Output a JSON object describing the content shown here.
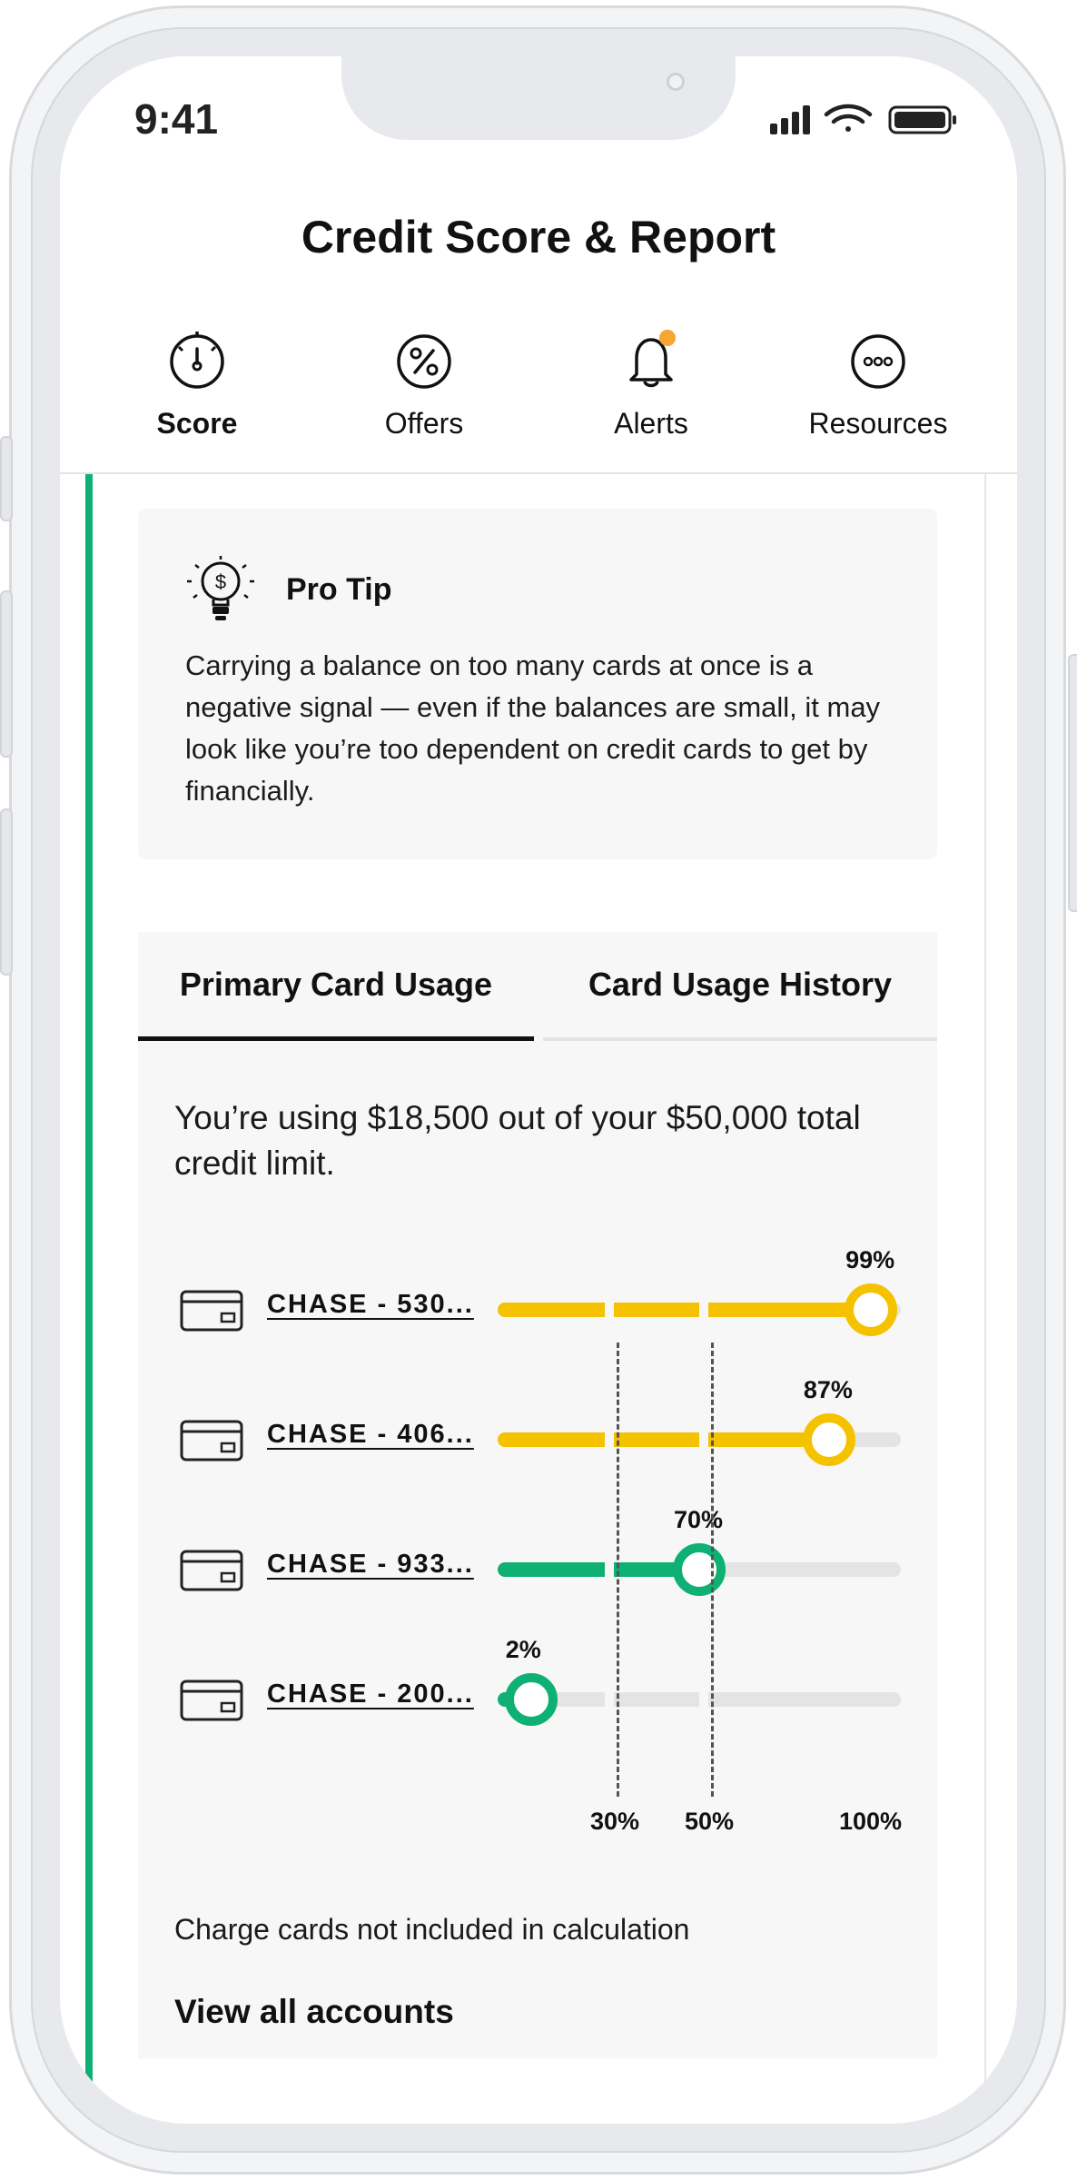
{
  "status_bar": {
    "time": "9:41"
  },
  "header": {
    "title": "Credit Score & Report",
    "nav": [
      {
        "label": "Score",
        "icon": "gauge-icon",
        "active": true
      },
      {
        "label": "Offers",
        "icon": "percent-icon"
      },
      {
        "label": "Alerts",
        "icon": "bell-icon",
        "has_notification_dot": true
      },
      {
        "label": "Resources",
        "icon": "more-icon"
      }
    ]
  },
  "pro_tip": {
    "icon": "lightbulb-dollar-icon",
    "title": "Pro Tip",
    "text": "Carrying a balance on too many cards at once is a negative signal — even if the balances are small, it may look like you’re too dependent on credit cards to get by financially."
  },
  "usage": {
    "tabs": [
      "Primary Card Usage",
      "Card Usage History"
    ],
    "active_tab": "Primary Card Usage",
    "summary": "You’re using $18,500 out of your $50,000 total credit limit.",
    "cards": [
      {
        "name": "CHASE - 530...",
        "percent_label": "99%",
        "utilization": 99,
        "color": "#f5c200"
      },
      {
        "name": "CHASE - 406...",
        "percent_label": "87%",
        "utilization": 87,
        "color": "#f5c200"
      },
      {
        "name": "CHASE - 933...",
        "percent_label": "70%",
        "utilization": 50,
        "color": "#0fb073"
      },
      {
        "name": "CHASE - 200...",
        "percent_label": "2%",
        "utilization": 2,
        "color": "#0fb073"
      }
    ],
    "axis_ticks": [
      "30%",
      "50%",
      "100%"
    ],
    "footnote": "Charge cards not included in calculation",
    "view_all": "View all accounts"
  },
  "colors": {
    "accent_green": "#0fb073",
    "warning_yellow": "#f5c200",
    "notification_orange": "#f7a533",
    "track_gray": "#e4e4e4"
  }
}
